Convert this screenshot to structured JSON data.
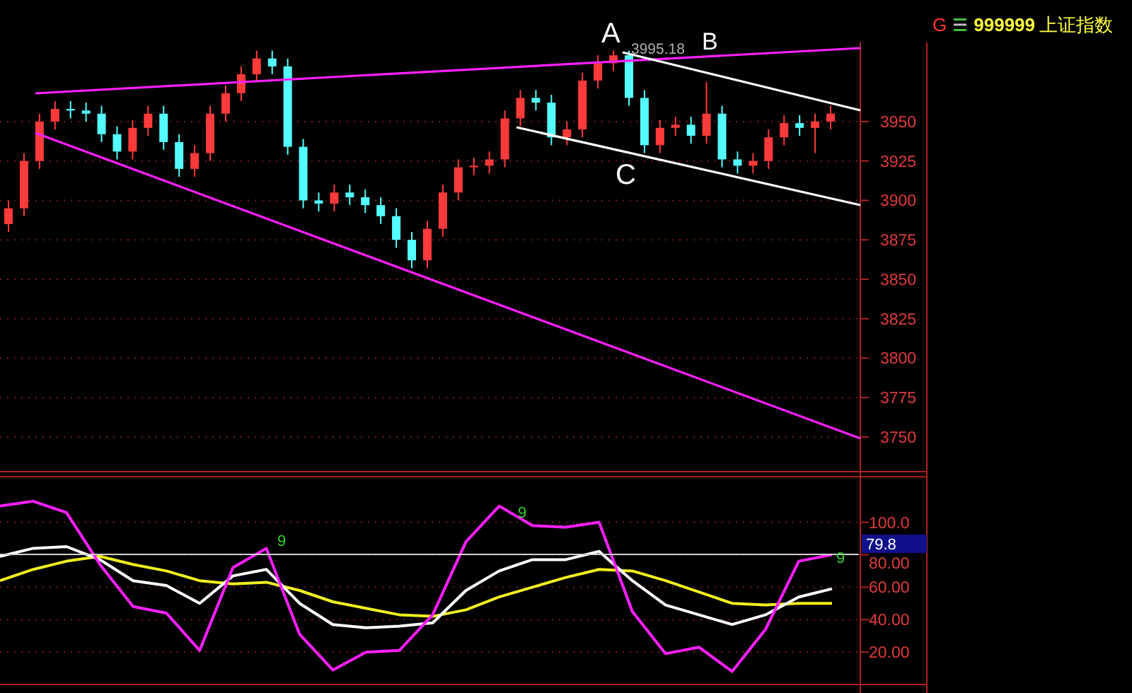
{
  "header": {
    "market_letter": "G",
    "code": "999999",
    "name": "上证指数"
  },
  "price_chart": {
    "point_labels": [
      {
        "text": "A"
      },
      {
        "text": "B"
      },
      {
        "text": "C"
      }
    ],
    "high_marker": "3995.18",
    "chart_data": {
      "type": "candlestick",
      "grid": true,
      "ylim": [
        3728,
        4000
      ],
      "yticks": [
        3950,
        3925,
        3900,
        3875,
        3850,
        3825,
        3800,
        3775,
        3750
      ],
      "ohlc": [
        [
          3885,
          3900,
          3880,
          3895
        ],
        [
          3895,
          3930,
          3890,
          3925
        ],
        [
          3925,
          3955,
          3920,
          3950
        ],
        [
          3950,
          3963,
          3945,
          3958
        ],
        [
          3958,
          3963,
          3952,
          3957
        ],
        [
          3957,
          3962,
          3950,
          3955
        ],
        [
          3955,
          3960,
          3937,
          3942
        ],
        [
          3942,
          3947,
          3926,
          3931
        ],
        [
          3931,
          3951,
          3926,
          3946
        ],
        [
          3946,
          3960,
          3941,
          3955
        ],
        [
          3955,
          3960,
          3932,
          3937
        ],
        [
          3937,
          3942,
          3915,
          3920
        ],
        [
          3920,
          3935,
          3915,
          3930
        ],
        [
          3930,
          3960,
          3925,
          3955
        ],
        [
          3955,
          3973,
          3950,
          3968
        ],
        [
          3968,
          3985,
          3963,
          3980
        ],
        [
          3980,
          3995,
          3975,
          3990
        ],
        [
          3990,
          3995,
          3980,
          3985
        ],
        [
          3985,
          3990,
          3929,
          3934
        ],
        [
          3934,
          3939,
          3895,
          3900
        ],
        [
          3900,
          3905,
          3893,
          3898
        ],
        [
          3898,
          3910,
          3893,
          3905
        ],
        [
          3905,
          3910,
          3897,
          3902
        ],
        [
          3902,
          3907,
          3892,
          3897
        ],
        [
          3897,
          3902,
          3885,
          3890
        ],
        [
          3890,
          3895,
          3870,
          3875
        ],
        [
          3875,
          3880,
          3857,
          3862
        ],
        [
          3862,
          3887,
          3857,
          3882
        ],
        [
          3882,
          3910,
          3877,
          3905
        ],
        [
          3905,
          3926,
          3900,
          3921
        ],
        [
          3921,
          3927,
          3916,
          3922
        ],
        [
          3922,
          3931,
          3917,
          3926
        ],
        [
          3926,
          3957,
          3921,
          3952
        ],
        [
          3952,
          3970,
          3947,
          3965
        ],
        [
          3965,
          3970,
          3957,
          3962
        ],
        [
          3962,
          3967,
          3935,
          3940
        ],
        [
          3940,
          3950,
          3935,
          3945
        ],
        [
          3945,
          3981,
          3940,
          3976
        ],
        [
          3976,
          3992,
          3971,
          3987
        ],
        [
          3987,
          3995,
          3982,
          3992
        ],
        [
          3992,
          3995,
          3960,
          3965
        ],
        [
          3965,
          3970,
          3930,
          3935
        ],
        [
          3935,
          3951,
          3930,
          3946
        ],
        [
          3946,
          3953,
          3941,
          3948
        ],
        [
          3948,
          3953,
          3936,
          3941
        ],
        [
          3941,
          3975,
          3936,
          3955
        ],
        [
          3955,
          3960,
          3921,
          3926
        ],
        [
          3926,
          3931,
          3917,
          3922
        ],
        [
          3922,
          3930,
          3917,
          3925
        ],
        [
          3925,
          3945,
          3920,
          3940
        ],
        [
          3940,
          3954,
          3935,
          3949
        ],
        [
          3949,
          3954,
          3941,
          3946
        ],
        [
          3946,
          3955,
          3930,
          3950
        ],
        [
          3950,
          3960,
          3945,
          3955
        ]
      ]
    }
  },
  "indicator": {
    "current_value": "79.8",
    "signal_marks": [
      "9",
      "9",
      "9"
    ],
    "chart_data": {
      "type": "line",
      "grid": true,
      "ylim": [
        0,
        128
      ],
      "yticks": [
        {
          "value": 100,
          "label": "100.0"
        },
        {
          "value": 80,
          "label": "80.00"
        },
        {
          "value": 60,
          "label": "60.00"
        },
        {
          "value": 40,
          "label": "40.00"
        },
        {
          "value": 20,
          "label": "20.00"
        }
      ],
      "series": [
        {
          "color": "#f0f020",
          "values": [
            64,
            71,
            76,
            79,
            74,
            70,
            64,
            62,
            63,
            58,
            51,
            47,
            43,
            42,
            46,
            54,
            60,
            66,
            71,
            70,
            64,
            57,
            50,
            49,
            50,
            50
          ]
        },
        {
          "color": "#ffffff",
          "values": [
            79,
            84,
            85,
            77,
            64,
            61,
            50,
            67,
            71,
            50,
            37,
            35,
            36,
            38,
            58,
            70,
            77,
            77,
            82,
            64,
            49,
            43,
            37,
            43,
            54,
            59
          ]
        },
        {
          "color": "#ff20ff",
          "values": [
            110,
            113,
            106,
            74,
            48,
            44,
            21,
            72,
            84,
            31,
            9,
            20,
            21,
            43,
            88,
            110,
            98,
            97,
            100,
            45,
            19,
            23,
            8,
            34,
            76,
            80
          ]
        }
      ]
    }
  }
}
